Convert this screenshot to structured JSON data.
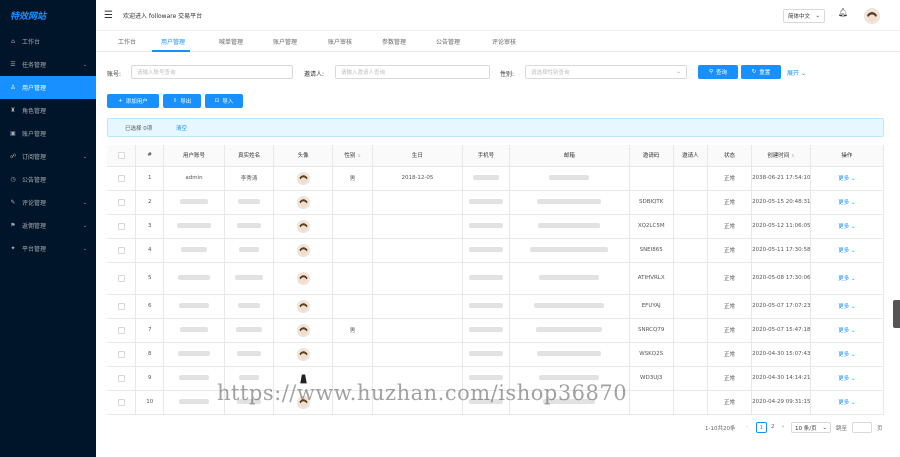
{
  "sidebar": {
    "logo": "特效网站",
    "items": [
      {
        "label": "工作台",
        "icon": "home-icon",
        "glyph": "⌂",
        "active": false,
        "arrow": false
      },
      {
        "label": "任务管理",
        "icon": "task-icon",
        "glyph": "☰",
        "active": false,
        "arrow": true
      },
      {
        "label": "用户管理",
        "icon": "user-icon",
        "glyph": "♙",
        "active": true,
        "arrow": false
      },
      {
        "label": "角色管理",
        "icon": "role-icon",
        "glyph": "♜",
        "active": false,
        "arrow": false
      },
      {
        "label": "账户管理",
        "icon": "account-icon",
        "glyph": "▣",
        "active": false,
        "arrow": false
      },
      {
        "label": "订阅管理",
        "icon": "subscribe-icon",
        "glyph": "☍",
        "active": false,
        "arrow": true
      },
      {
        "label": "公告管理",
        "icon": "notice-icon",
        "glyph": "◷",
        "active": false,
        "arrow": false
      },
      {
        "label": "评论管理",
        "icon": "comment-icon",
        "glyph": "✎",
        "active": false,
        "arrow": true
      },
      {
        "label": "返佣管理",
        "icon": "rebate-icon",
        "glyph": "⚑",
        "active": false,
        "arrow": true
      },
      {
        "label": "平台管理",
        "icon": "platform-icon",
        "glyph": "✦",
        "active": false,
        "arrow": true
      }
    ]
  },
  "header": {
    "welcome": "欢迎进入 followare 交易平台",
    "lang": "简体中文"
  },
  "tabs": [
    "工作台",
    "用户管理",
    "喊单管理",
    "账户管理",
    "账户审核",
    "参数管理",
    "公告管理",
    "评论审核"
  ],
  "search": {
    "account_label": "账号:",
    "account_placeholder": "请输入账号查询",
    "inviter_label": "邀请人:",
    "inviter_placeholder": "请输入邀请人查询",
    "gender_label": "性别:",
    "gender_placeholder": "请选择性别查询",
    "query_btn": "查询",
    "reset_btn": "重置",
    "expand": "展开"
  },
  "toolbar": {
    "add": "添加用户",
    "export": "导出",
    "import": "导入"
  },
  "selection": {
    "text": "已选择 0项",
    "clear": "清空"
  },
  "table": {
    "headers": [
      "",
      "#",
      "用户账号",
      "真实姓名",
      "头像",
      "性别",
      "生日",
      "手机号",
      "邮箱",
      "邀请码",
      "邀请人",
      "状态",
      "创建时间",
      "操作"
    ],
    "rows": [
      {
        "no": "1",
        "account": "admin",
        "name": "李秀涛",
        "gender": "男",
        "birthday": "2018-12-05",
        "code": "",
        "status": "正常",
        "created": "2038-06-21 17:54:10",
        "action": "更多",
        "blurred": false,
        "dark_avatar": false
      },
      {
        "no": "2",
        "account": "",
        "name": "",
        "gender": "",
        "birthday": "",
        "code": "SDBIQTK",
        "status": "正常",
        "created": "2020-05-15 20:48:31",
        "action": "更多",
        "blurred": true,
        "dark_avatar": false
      },
      {
        "no": "3",
        "account": "",
        "name": "",
        "gender": "",
        "birthday": "",
        "code": "XQ2LC5M",
        "status": "正常",
        "created": "2020-05-12 11:06:05",
        "action": "更多",
        "blurred": true,
        "dark_avatar": false
      },
      {
        "no": "4",
        "account": "",
        "name": "",
        "gender": "",
        "birthday": "",
        "code": "SNEI865",
        "status": "正常",
        "created": "2020-05-11 17:30:58",
        "action": "更多",
        "blurred": true,
        "dark_avatar": false
      },
      {
        "no": "5",
        "account": "",
        "name": "",
        "gender": "",
        "birthday": "",
        "code": "ATIHVRLX",
        "status": "正常",
        "created": "2020-05-08 17:30:06",
        "action": "更多",
        "blurred": true,
        "dark_avatar": false
      },
      {
        "no": "6",
        "account": "",
        "name": "",
        "gender": "",
        "birthday": "",
        "code": "EFUYAJ",
        "status": "正常",
        "created": "2020-05-07 17:07:23",
        "action": "更多",
        "blurred": true,
        "dark_avatar": false
      },
      {
        "no": "7",
        "account": "",
        "name": "",
        "gender": "男",
        "birthday": "",
        "code": "SNRCQ79",
        "status": "正常",
        "created": "2020-05-07 15:47:18",
        "action": "更多",
        "blurred": true,
        "dark_avatar": false
      },
      {
        "no": "8",
        "account": "",
        "name": "",
        "gender": "",
        "birthday": "",
        "code": "WSKQ2S",
        "status": "正常",
        "created": "2020-04-30 15:07:43",
        "action": "更多",
        "blurred": true,
        "dark_avatar": false
      },
      {
        "no": "9",
        "account": "",
        "name": "",
        "gender": "",
        "birthday": "",
        "code": "WD3UJ3",
        "status": "正常",
        "created": "2020-04-30 14:14:21",
        "action": "更多",
        "blurred": true,
        "dark_avatar": true
      },
      {
        "no": "10",
        "account": "",
        "name": "",
        "gender": "",
        "birthday": "",
        "code": "",
        "status": "正常",
        "created": "2020-04-29 09:31:15",
        "action": "更多",
        "blurred": true,
        "dark_avatar": false
      }
    ]
  },
  "pagination": {
    "total": "1-10共20条",
    "page1": "1",
    "page2": "2",
    "size": "10 条/页",
    "goto": "跳至",
    "unit": "页"
  },
  "watermark": "https://www.huzhan.com/ishop36870",
  "colors": {
    "primary": "#1890ff",
    "sidebar": "#001529"
  }
}
